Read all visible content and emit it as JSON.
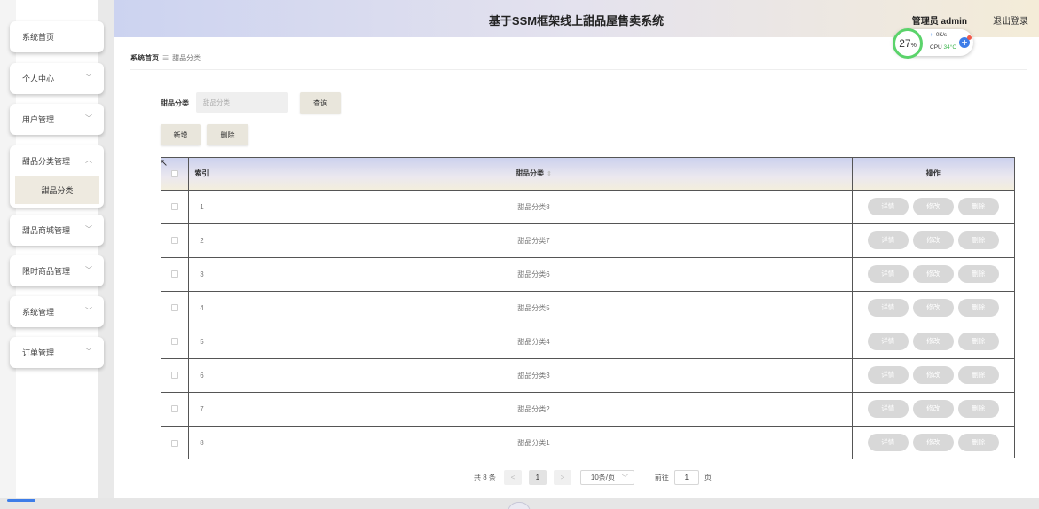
{
  "header": {
    "title": "基于SSM框架线上甜品屋售卖系统",
    "user_text": "管理员 admin",
    "logout": "退出登录"
  },
  "cpu_widget": {
    "percent": "27",
    "percent_unit": "%",
    "net_speed": "0K/s",
    "cpu_label": "CPU",
    "temperature": "34°C",
    "ring_color": "#5bd36b"
  },
  "sidebar": {
    "items": [
      {
        "label": "系统首页",
        "has_chevron": false
      },
      {
        "label": "个人中心",
        "has_chevron": true
      },
      {
        "label": "用户管理",
        "has_chevron": true
      },
      {
        "label": "甜品分类管理",
        "has_chevron": true,
        "expanded": true
      },
      {
        "label": "甜品商城管理",
        "has_chevron": true
      },
      {
        "label": "限时商品管理",
        "has_chevron": true
      },
      {
        "label": "系统管理",
        "has_chevron": true
      },
      {
        "label": "订单管理",
        "has_chevron": true
      }
    ],
    "submenu_active": "甜品分类"
  },
  "breadcrumb": {
    "home": "系统首页",
    "separator": "☰",
    "current": "甜品分类"
  },
  "search": {
    "label": "甜品分类",
    "placeholder": "甜品分类",
    "query_button": "查询"
  },
  "actions": {
    "add_button": "新增",
    "delete_button": "删除"
  },
  "table": {
    "headers": {
      "index": "索引",
      "category": "甜品分类",
      "operations": "操作"
    },
    "rows": [
      {
        "index": "1",
        "category": "甜品分类8"
      },
      {
        "index": "2",
        "category": "甜品分类7"
      },
      {
        "index": "3",
        "category": "甜品分类6"
      },
      {
        "index": "4",
        "category": "甜品分类5"
      },
      {
        "index": "5",
        "category": "甜品分类4"
      },
      {
        "index": "6",
        "category": "甜品分类3"
      },
      {
        "index": "7",
        "category": "甜品分类2"
      },
      {
        "index": "8",
        "category": "甜品分类1"
      }
    ],
    "row_buttons": {
      "detail": "详情",
      "edit": "修改",
      "delete": "删除"
    }
  },
  "pagination": {
    "total": "共 8 条",
    "prev": "<",
    "current_page": "1",
    "next": ">",
    "page_size": "10条/页",
    "goto_label": "前往",
    "goto_value": "1",
    "page_suffix": "页"
  },
  "colors": {
    "accent_blue": "#3d7de8",
    "button_bg": "#e9e6dc",
    "op_button_bg": "#d8d8d8"
  }
}
